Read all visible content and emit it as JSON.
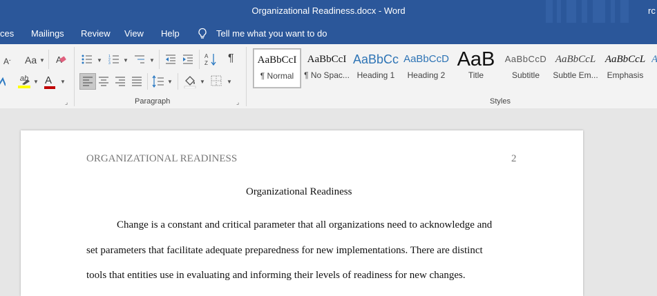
{
  "titlebar": {
    "title": "Organizational Readiness.docx  -  Word",
    "edge_text": "rc"
  },
  "menubar": {
    "tabs": [
      "ces",
      "Mailings",
      "Review",
      "View",
      "Help"
    ],
    "tell_me": "Tell me what you want to do"
  },
  "ribbon": {
    "font_group": {
      "change_case": "Aa",
      "highlight_text": "ab"
    },
    "paragraph_label": "Paragraph",
    "styles_label": "Styles",
    "styles": [
      {
        "sample": "AaBbCcI",
        "name": "¶ Normal",
        "selected": true
      },
      {
        "sample": "AaBbCcI",
        "name": "¶ No Spac..."
      },
      {
        "sample": "AaBbCc",
        "name": "Heading 1"
      },
      {
        "sample": "AaBbCcD",
        "name": "Heading 2"
      },
      {
        "sample": "AaB",
        "name": "Title"
      },
      {
        "sample": "AaBbCcD",
        "name": "Subtitle"
      },
      {
        "sample": "AaBbCcL",
        "name": "Subtle Em..."
      },
      {
        "sample": "AaBbCcL",
        "name": "Emphasis"
      },
      {
        "sample": "A",
        "name": ""
      }
    ],
    "colors": {
      "highlight": "#ffff00",
      "font_color": "#c00000",
      "accent": "#2b579a"
    }
  },
  "document": {
    "header_text": "ORGANIZATIONAL READINESS",
    "page_number": "2",
    "title": "Organizational Readiness",
    "lines": [
      "Change is a constant and critical parameter that all organizations need to acknowledge and",
      "set parameters that facilitate adequate preparedness for new implementations. There are distinct",
      "tools that entities use in evaluating and informing their levels of readiness for new changes."
    ]
  }
}
